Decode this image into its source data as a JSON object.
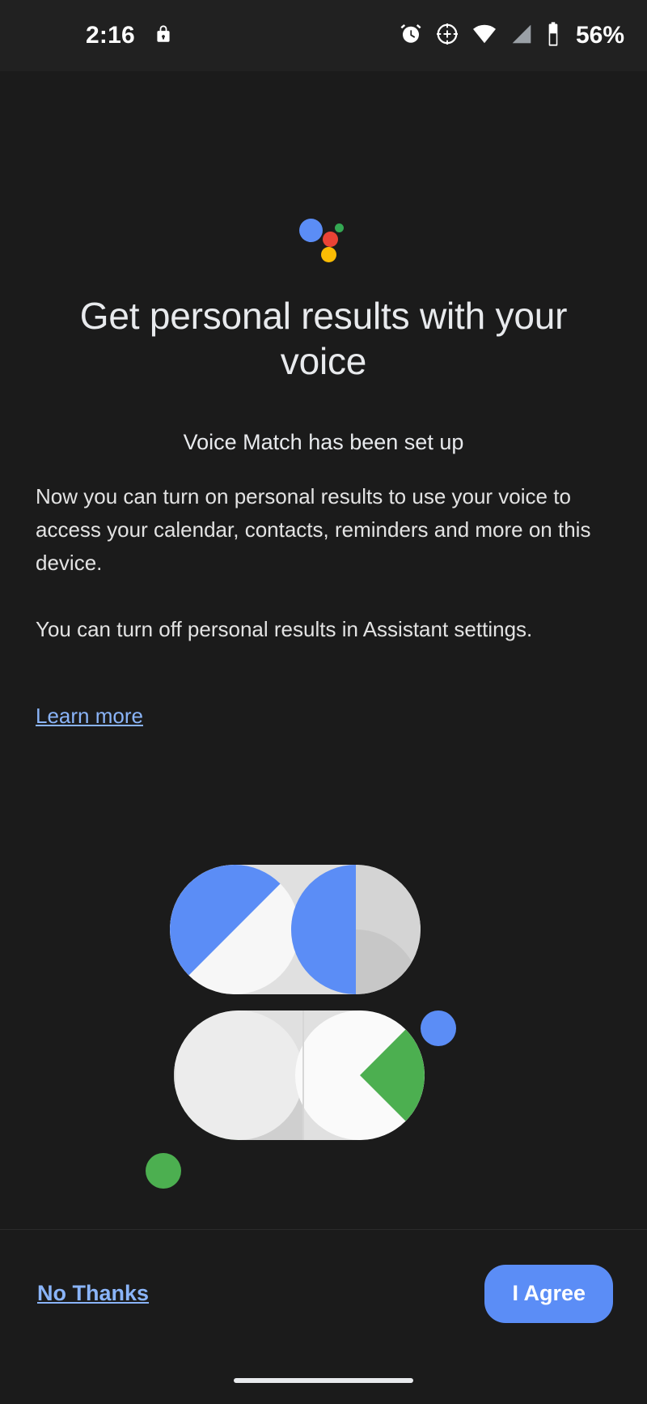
{
  "status_bar": {
    "time": "2:16",
    "battery_percent": "56%",
    "icons": [
      "lock-icon",
      "alarm-icon",
      "location-crosshair-icon",
      "wifi-icon",
      "cell-signal-icon",
      "battery-icon"
    ]
  },
  "header": {
    "logo": "google-assistant-logo",
    "title": "Get personal results with your voice",
    "subtitle": "Voice Match has been set up"
  },
  "body": {
    "paragraph_1": "Now you can turn on personal results to use your voice to access your calendar, contacts, reminders and more on this device.",
    "paragraph_2": "You can turn off personal results in Assistant settings.",
    "learn_more_label": "Learn more"
  },
  "illustration": {
    "name": "voice-match-abstract-illustration"
  },
  "footer": {
    "decline_label": "No Thanks",
    "accept_label": "I Agree"
  },
  "colors": {
    "background": "#1b1b1b",
    "status_bar_bg": "#212121",
    "accent_blue": "#5b8df6",
    "link_blue": "#8ab4f8",
    "text_primary": "#e8eaed",
    "google_red": "#ea4335",
    "google_green": "#34a853",
    "google_yellow": "#fbbc04",
    "illustration_green": "#4caf50",
    "illustration_white": "#f5f5f5",
    "illustration_grey": "#dcdcdc"
  }
}
